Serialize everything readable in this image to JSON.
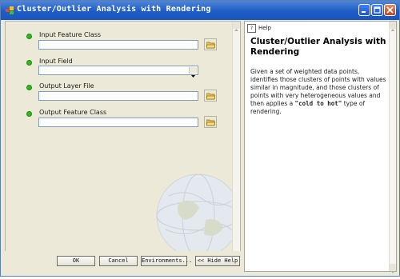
{
  "window": {
    "title": "Cluster/Outlier Analysis with Rendering"
  },
  "form": {
    "fields": [
      {
        "label": "Input Feature Class",
        "value": ""
      },
      {
        "label": "Input Field",
        "value": ""
      },
      {
        "label": "Output Layer File",
        "value": ""
      },
      {
        "label": "Output Feature Class",
        "value": ""
      }
    ]
  },
  "buttons": {
    "ok": "OK",
    "cancel": "Cancel",
    "environments": "Environments...",
    "hide_help": "<< Hide Help"
  },
  "help": {
    "tab_label": "Help",
    "title": "Cluster/Outlier Analysis with Rendering",
    "body": "Given a set of weighted data points, identifies those clusters of points with values similar in magnitude, and those clusters of points with very heterogeneous values and then applies a",
    "quote": "\"cold to hot\"",
    "suffix": "type of rendering."
  },
  "colors": {
    "titlebar": "#1e5cc7",
    "bullet": "#2fb91a",
    "panel": "#ece9d8"
  }
}
